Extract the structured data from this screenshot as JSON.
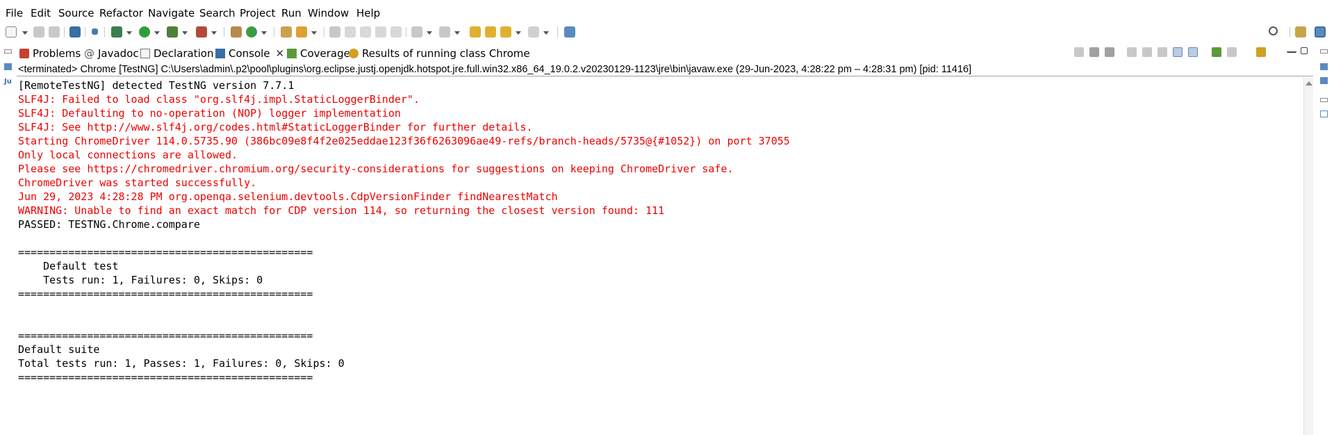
{
  "menubar": {
    "items": [
      "File",
      "Edit",
      "Source",
      "Refactor",
      "Navigate",
      "Search",
      "Project",
      "Run",
      "Window",
      "Help"
    ]
  },
  "tabs": [
    {
      "label": "Problems",
      "icon": "problems-icon"
    },
    {
      "label": "Javadoc",
      "prefix": "@",
      "icon": "javadoc-icon"
    },
    {
      "label": "Declaration",
      "icon": "declaration-icon"
    },
    {
      "label": "Console",
      "icon": "console-icon",
      "active": true,
      "close": "✕"
    },
    {
      "label": "Coverage",
      "icon": "coverage-icon"
    },
    {
      "label": "Results of running class Chrome",
      "icon": "testng-icon"
    }
  ],
  "statusline": "<terminated> Chrome [TestNG] C:\\Users\\admin\\.p2\\pool\\plugins\\org.eclipse.justj.openjdk.hotspot.jre.full.win32.x86_64_19.0.2.v20230129-1123\\jre\\bin\\javaw.exe  (29-Jun-2023, 4:28:22 pm – 4:28:31 pm) [pid: 11416]",
  "console": {
    "lines": [
      {
        "text": "[RemoteTestNG] detected TestNG version 7.7.1",
        "color": "black"
      },
      {
        "text": "SLF4J: Failed to load class \"org.slf4j.impl.StaticLoggerBinder\".",
        "color": "red"
      },
      {
        "text": "SLF4J: Defaulting to no-operation (NOP) logger implementation",
        "color": "red"
      },
      {
        "text": "SLF4J: See http://www.slf4j.org/codes.html#StaticLoggerBinder for further details.",
        "color": "red"
      },
      {
        "text": "Starting ChromeDriver 114.0.5735.90 (386bc09e8f4f2e025eddae123f36f6263096ae49-refs/branch-heads/5735@{#1052}) on port 37055",
        "color": "red"
      },
      {
        "text": "Only local connections are allowed.",
        "color": "red"
      },
      {
        "text": "Please see https://chromedriver.chromium.org/security-considerations for suggestions on keeping ChromeDriver safe.",
        "color": "red"
      },
      {
        "text": "ChromeDriver was started successfully.",
        "color": "red"
      },
      {
        "text": "Jun 29, 2023 4:28:28 PM org.openqa.selenium.devtools.CdpVersionFinder findNearestMatch",
        "color": "red"
      },
      {
        "text": "WARNING: Unable to find an exact match for CDP version 114, so returning the closest version found: 111",
        "color": "red"
      },
      {
        "text": "PASSED: TESTNG.Chrome.compare",
        "color": "black"
      },
      {
        "text": "",
        "color": "black"
      },
      {
        "text": "===============================================",
        "color": "black"
      },
      {
        "text": "    Default test",
        "color": "black"
      },
      {
        "text": "    Tests run: 1, Failures: 0, Skips: 0",
        "color": "black"
      },
      {
        "text": "===============================================",
        "color": "black"
      },
      {
        "text": "",
        "color": "black"
      },
      {
        "text": "",
        "color": "black"
      },
      {
        "text": "===============================================",
        "color": "black"
      },
      {
        "text": "Default suite",
        "color": "black"
      },
      {
        "text": "Total tests run: 1, Passes: 1, Failures: 0, Skips: 0",
        "color": "black"
      },
      {
        "text": "===============================================",
        "color": "black"
      }
    ]
  },
  "colors": {
    "error_text": "#ee0000",
    "normal_text": "#000000",
    "run_green": "#2e9e3a",
    "warn_orange": "#e08a00"
  }
}
